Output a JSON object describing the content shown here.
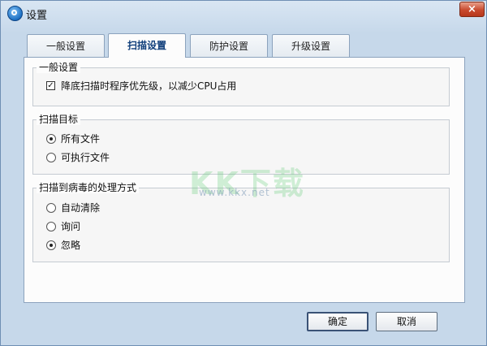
{
  "window": {
    "title": "设置",
    "close_glyph": "×"
  },
  "tabs": [
    {
      "label": "一般设置",
      "active": false
    },
    {
      "label": "扫描设置",
      "active": true
    },
    {
      "label": "防护设置",
      "active": false
    },
    {
      "label": "升级设置",
      "active": false
    }
  ],
  "groups": {
    "general": {
      "title": "一般设置",
      "low_priority": {
        "label": "降底扫描时程序优先级，以减少CPU占用",
        "checked": true
      }
    },
    "scan_target": {
      "title": "扫描目标",
      "options": [
        {
          "label": "所有文件",
          "selected": true
        },
        {
          "label": "可执行文件",
          "selected": false
        }
      ]
    },
    "virus_action": {
      "title": "扫描到病毒的处理方式",
      "options": [
        {
          "label": "自动清除",
          "selected": false
        },
        {
          "label": "询问",
          "selected": false
        },
        {
          "label": "忽略",
          "selected": true
        }
      ]
    }
  },
  "buttons": {
    "ok": "确定",
    "cancel": "取消"
  },
  "watermark": {
    "text": "KK下载",
    "url": "www.kkx.net"
  },
  "icons": {
    "app": "shield-scan-icon",
    "close": "close-icon",
    "check": "✓"
  }
}
